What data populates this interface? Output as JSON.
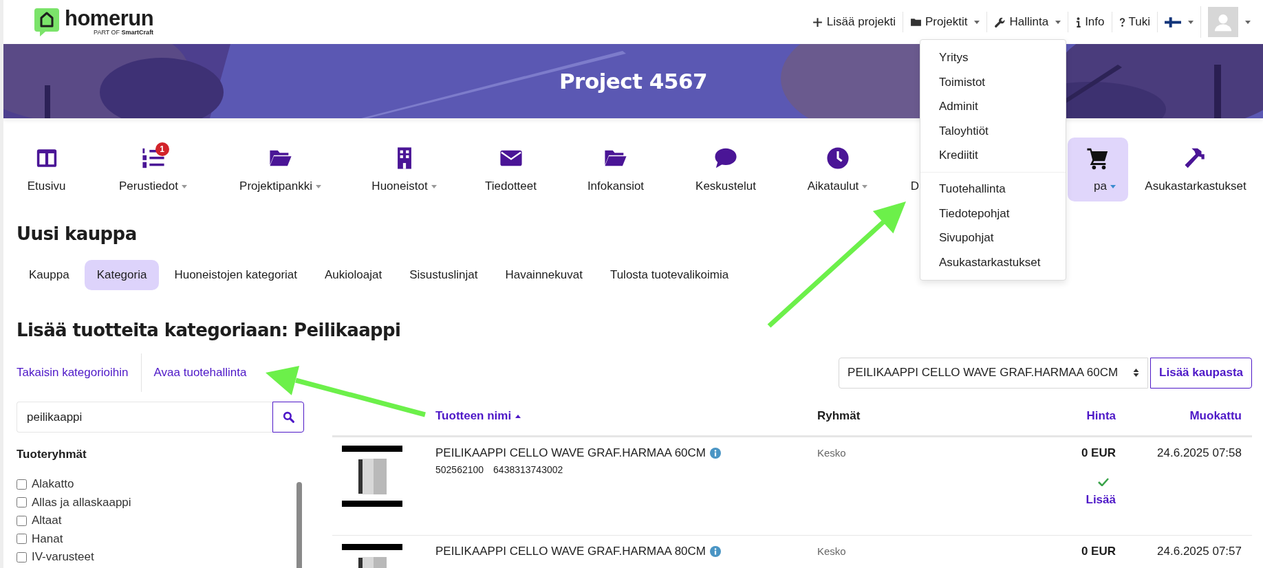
{
  "header": {
    "logo": {
      "name": "homerun",
      "tagline": "PART OF **SmartCraft**"
    },
    "menu": [
      {
        "label": "Lisää projekti",
        "caret": false
      },
      {
        "label": "Projektit",
        "caret": true
      },
      {
        "label": "Hallinta",
        "caret": true,
        "expanded": true,
        "items": [
          [
            "Yritys",
            "Toimistot",
            "Adminit",
            "Taloyhtiöt",
            "Krediitit"
          ],
          [
            "Tuotehallinta",
            "Tiedotepohjat",
            "Sivupohjat",
            "Asukastarkastukset"
          ]
        ]
      },
      {
        "label": "Info",
        "caret": false
      },
      {
        "label": "Tuki",
        "caret": false
      }
    ]
  },
  "banner": {
    "title": "Project 4567"
  },
  "nav": [
    {
      "label": "Etusivu",
      "caret": false,
      "selected": false
    },
    {
      "label": "Perustiedot",
      "caret": true,
      "selected": false,
      "badge": "1"
    },
    {
      "label": "Projektipankki",
      "caret": true,
      "selected": false
    },
    {
      "label": "Huoneistot",
      "caret": true,
      "selected": false
    },
    {
      "label": "Tiedotteet",
      "caret": false,
      "selected": false
    },
    {
      "label": "Infokansiot",
      "caret": false,
      "selected": false
    },
    {
      "label": "Keskustelut",
      "caret": false,
      "selected": false
    },
    {
      "label": "Aikataulut",
      "caret": true,
      "selected": false
    },
    {
      "label": "D",
      "caret": false,
      "selected": false
    },
    {
      "label": "pa",
      "caret": true,
      "selected": true
    },
    {
      "label": "Asukastarkastukset",
      "caret": false,
      "selected": false
    }
  ],
  "page_title": "Uusi kauppa",
  "tabs": [
    {
      "label": "Kauppa",
      "selected": false
    },
    {
      "label": "Kategoria",
      "selected": true
    },
    {
      "label": "Huoneistojen kategoriat",
      "selected": false
    },
    {
      "label": "Aukioloajat",
      "selected": false
    },
    {
      "label": "Sisustuslinjat",
      "selected": false
    },
    {
      "label": "Havainnekuvat",
      "selected": false
    },
    {
      "label": "Tulosta tuotevalikoimia",
      "selected": false
    }
  ],
  "section_title": "Lisää tuotteita kategoriaan: Peilikaappi",
  "links": [
    "Takaisin kategorioihin",
    "Avaa tuotehallinta"
  ],
  "product_select": {
    "value": "PEILIKAAPPI CELLO WAVE GRAF.HARMAA 60CM"
  },
  "add_button": "Lisää kaupasta",
  "search": {
    "value": "peilikaappi"
  },
  "groups": {
    "title": "Tuoteryhmät",
    "items": [
      {
        "label": "Alakatto",
        "checked": false
      },
      {
        "label": "Allas ja allaskaappi",
        "checked": false
      },
      {
        "label": "Altaat",
        "checked": false
      },
      {
        "label": "Hanat",
        "checked": false
      },
      {
        "label": "IV-varusteet",
        "checked": false
      }
    ]
  },
  "table": {
    "columns": [
      {
        "label": "Tuotteen nimi",
        "sortable": true,
        "sort_ascending": true
      },
      {
        "label": "Ryhmät",
        "sortable": false
      },
      {
        "label": "Hinta",
        "sortable": true
      },
      {
        "label": "Muokattu",
        "sortable": true
      }
    ],
    "rows": [
      {
        "name": "PEILIKAAPPI CELLO WAVE GRAF.HARMAA 60CM",
        "codes": [
          "502562100",
          "6438313743002"
        ],
        "group": "Kesko",
        "price": "0 EUR",
        "added": true,
        "action": "Lisää",
        "modified": "24.6.2025 07:58"
      },
      {
        "name": "PEILIKAAPPI CELLO WAVE GRAF.HARMAA 80CM",
        "group": "Kesko",
        "price": "0 EUR",
        "modified": "24.6.2025 07:57"
      }
    ]
  }
}
